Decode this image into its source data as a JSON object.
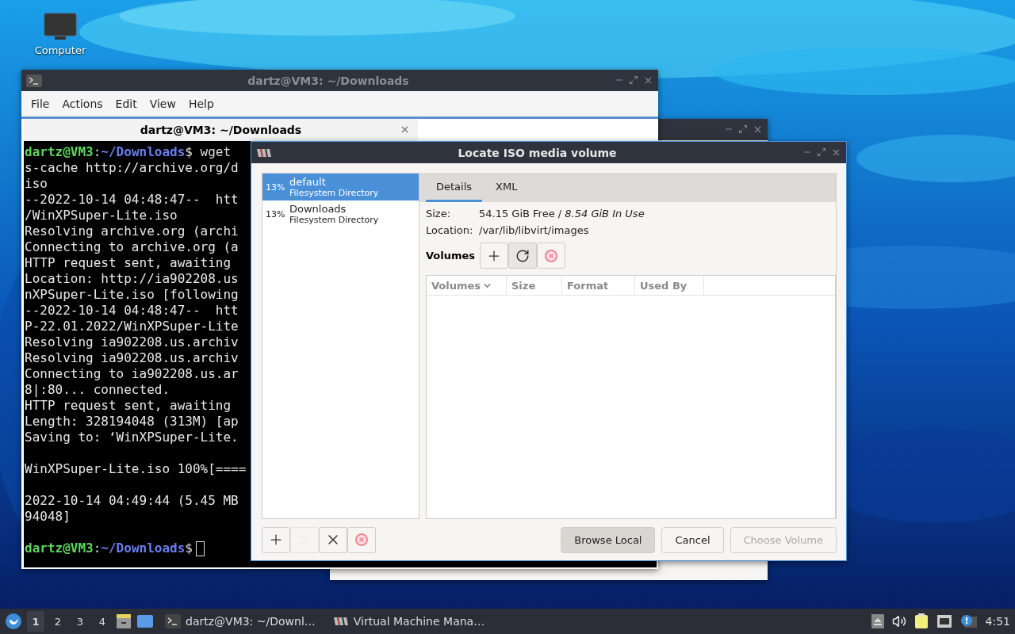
{
  "desktop": {
    "icons": [
      {
        "label": "Computer"
      }
    ]
  },
  "terminal": {
    "title": "dartz@VM3: ~/Downloads",
    "menu": [
      "File",
      "Actions",
      "Edit",
      "View",
      "Help"
    ],
    "tab": {
      "title": "dartz@VM3: ~/Downloads"
    },
    "lines": [
      {
        "kind": "prompt",
        "user": "dartz@VM3",
        "sep": ":",
        "path": "~/Downloads",
        "symbol": "$",
        "command": "wget",
        "cursor": false
      },
      {
        "kind": "output",
        "text": "s-cache http://archive.org/d"
      },
      {
        "kind": "output",
        "text": "iso"
      },
      {
        "kind": "output",
        "text": "--2022-10-14 04:48:47--  htt"
      },
      {
        "kind": "output",
        "text": "/WinXPSuper-Lite.iso"
      },
      {
        "kind": "output",
        "text": "Resolving archive.org (archi"
      },
      {
        "kind": "output",
        "text": "Connecting to archive.org (a"
      },
      {
        "kind": "output",
        "text": "HTTP request sent, awaiting"
      },
      {
        "kind": "output",
        "text": "Location: http://ia902208.us"
      },
      {
        "kind": "output",
        "text": "nXPSuper-Lite.iso [following"
      },
      {
        "kind": "output",
        "text": "--2022-10-14 04:48:47--  htt"
      },
      {
        "kind": "output",
        "text": "P-22.01.2022/WinXPSuper-Lite"
      },
      {
        "kind": "output",
        "text": "Resolving ia902208.us.archiv"
      },
      {
        "kind": "output",
        "text": "Resolving ia902208.us.archiv"
      },
      {
        "kind": "output",
        "text": "Connecting to ia902208.us.ar"
      },
      {
        "kind": "output",
        "text": "8|:80... connected."
      },
      {
        "kind": "output",
        "text": "HTTP request sent, awaiting"
      },
      {
        "kind": "output",
        "text": "Length: 328194048 (313M) [ap"
      },
      {
        "kind": "output",
        "text": "Saving to: ‘WinXPSuper-Lite."
      },
      {
        "kind": "blank"
      },
      {
        "kind": "output",
        "text": "WinXPSuper-Lite.iso 100%[===="
      },
      {
        "kind": "blank"
      },
      {
        "kind": "output",
        "text": "2022-10-14 04:49:44 (5.45 MB"
      },
      {
        "kind": "output",
        "text": "94048]"
      },
      {
        "kind": "blank"
      },
      {
        "kind": "prompt",
        "user": "dartz@VM3",
        "sep": ":",
        "path": "~/Downloads",
        "symbol": "$",
        "cursor": true
      }
    ]
  },
  "dialog": {
    "title": "Locate ISO media volume",
    "pools": [
      {
        "usage": "13%",
        "name": "default",
        "type": "Filesystem Directory",
        "selected": true
      },
      {
        "usage": "13%",
        "name": "Downloads",
        "type": "Filesystem Directory",
        "selected": false
      }
    ],
    "tabs": [
      {
        "label": "Details",
        "selected": true
      },
      {
        "label": "XML",
        "selected": false
      }
    ],
    "details": {
      "size_label": "Size:",
      "size_free": "54.15 GiB Free /",
      "size_used": "8.54 GiB In Use",
      "location_label": "Location:",
      "location": "/var/lib/libvirt/images"
    },
    "volumes_label": "Volumes",
    "volume_tools": [
      {
        "kind": "add",
        "disabled": false
      },
      {
        "kind": "refresh",
        "disabled": false
      },
      {
        "kind": "delete",
        "disabled": false
      }
    ],
    "columns": [
      {
        "label": "Volumes",
        "sorted": true
      },
      {
        "label": "Size",
        "sorted": false
      },
      {
        "label": "Format",
        "sorted": false
      },
      {
        "label": "Used By",
        "sorted": false
      }
    ],
    "pool_tools": [
      {
        "kind": "add",
        "disabled": false
      },
      {
        "kind": "start",
        "disabled": true
      },
      {
        "kind": "stop",
        "disabled": false
      },
      {
        "kind": "delete",
        "disabled": false
      }
    ],
    "buttons": [
      {
        "label": "Browse Local",
        "kind": "pressed",
        "disabled": false
      },
      {
        "label": "Cancel",
        "kind": "normal",
        "disabled": false
      },
      {
        "label": "Choose Volume",
        "kind": "normal",
        "disabled": true
      }
    ]
  },
  "taskbar": {
    "workspaces": [
      {
        "label": "1",
        "selected": true
      },
      {
        "label": "2",
        "selected": false
      },
      {
        "label": "3",
        "selected": false
      },
      {
        "label": "4",
        "selected": false
      }
    ],
    "tasks": [
      {
        "kind": "terminal",
        "label": "dartz@VM3: ~/Downl…"
      },
      {
        "kind": "vm",
        "label": "Virtual Machine Mana…"
      }
    ],
    "clock": "4:51"
  }
}
